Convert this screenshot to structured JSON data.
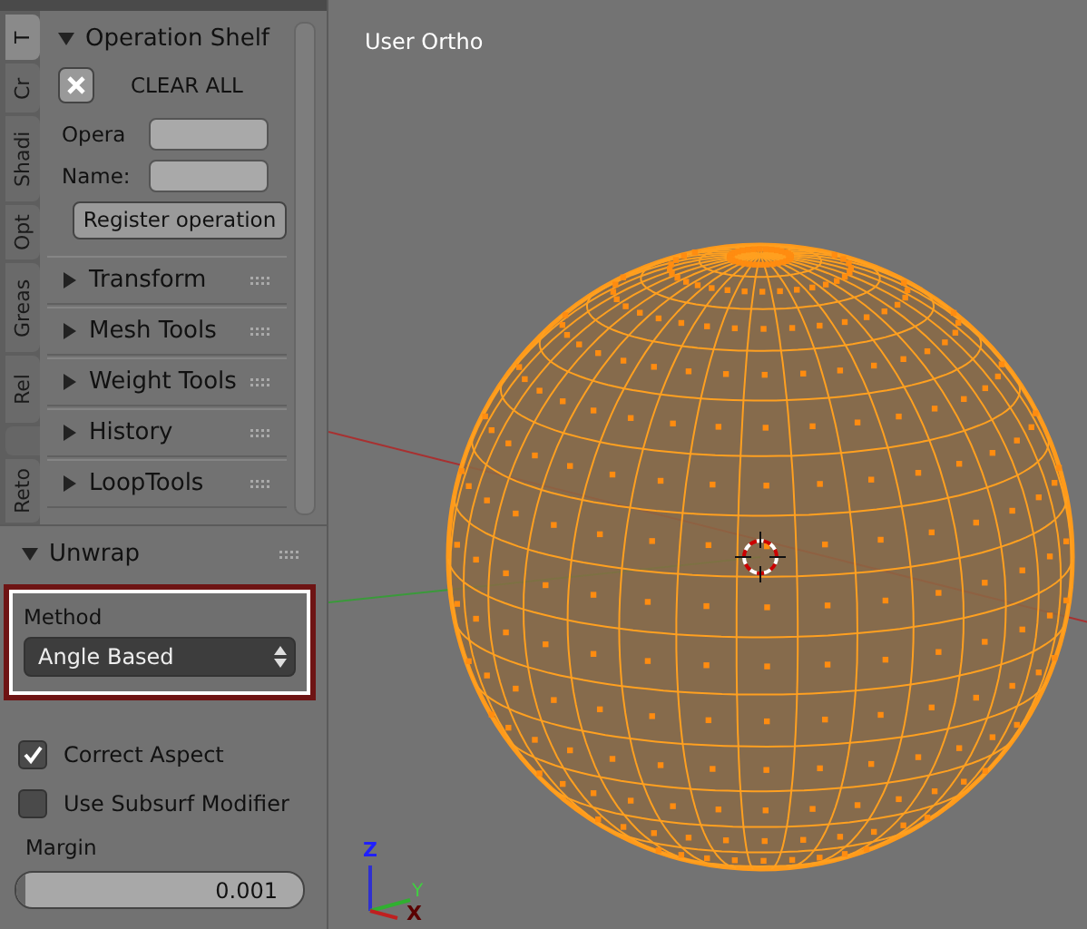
{
  "tool_tabs": [
    {
      "label": "T",
      "selected": true
    },
    {
      "label": "Cr",
      "selected": false
    },
    {
      "label": "Shadi",
      "selected": false
    },
    {
      "label": "Opt",
      "selected": false
    },
    {
      "label": "Greas",
      "selected": false
    },
    {
      "label": "Rel",
      "selected": false
    },
    {
      "label": "Reto",
      "selected": false
    }
  ],
  "operation_shelf": {
    "title": "Operation Shelf",
    "expanded": true,
    "clear_label": "CLEAR ALL",
    "fields": [
      {
        "label": "Opera"
      },
      {
        "label": "Name:"
      }
    ],
    "register_button": "Register operation"
  },
  "panels": [
    {
      "label": "Transform",
      "expanded": false
    },
    {
      "label": "Mesh Tools",
      "expanded": false
    },
    {
      "label": "Weight Tools",
      "expanded": false
    },
    {
      "label": "History",
      "expanded": false
    },
    {
      "label": "LoopTools",
      "expanded": false
    }
  ],
  "unwrap": {
    "title": "Unwrap",
    "expanded": true,
    "method_label": "Method",
    "method_value": "Angle Based",
    "options": [
      {
        "label": "Correct Aspect",
        "checked": true
      },
      {
        "label": "Use Subsurf Modifier",
        "checked": false
      }
    ],
    "margin": {
      "label": "Margin",
      "value": "0.001",
      "level": 0.03
    }
  },
  "viewport": {
    "title": "User Ortho",
    "axes": [
      "Z",
      "Y",
      "X"
    ]
  }
}
